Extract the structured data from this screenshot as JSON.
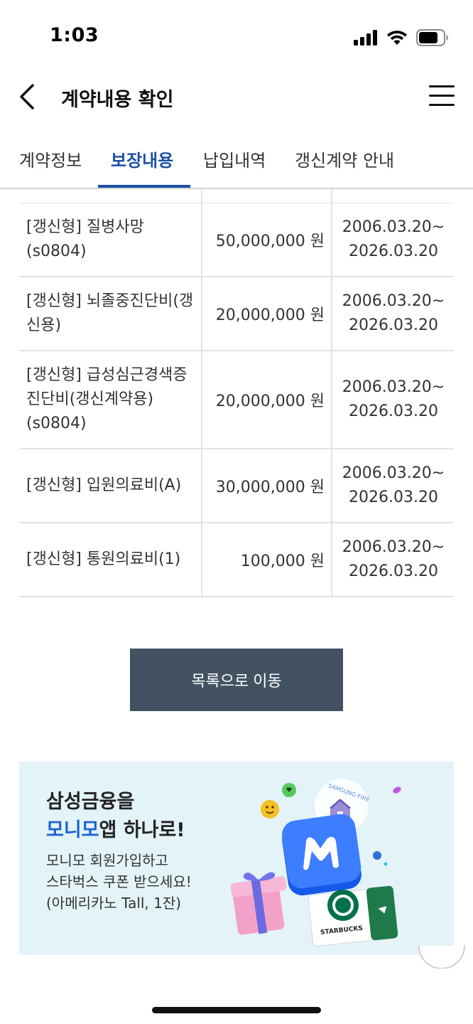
{
  "status": {
    "time": "1:03"
  },
  "header": {
    "title": "계약내용 확인"
  },
  "tabs": [
    {
      "label": "계약정보"
    },
    {
      "label": "보장내용"
    },
    {
      "label": "납입내역"
    },
    {
      "label": "갱신계약 안내"
    }
  ],
  "coverage": [
    {
      "name": "[갱신형] 질병사망(s0804)",
      "amount": "50,000,000 원",
      "period_start": "2006.03.20~",
      "period_end": "2026.03.20"
    },
    {
      "name": "[갱신형] 뇌졸중진단비(갱신용)",
      "amount": "20,000,000 원",
      "period_start": "2006.03.20~",
      "period_end": "2026.03.20"
    },
    {
      "name": "[갱신형] 급성심근경색증진단비(갱신계약용)(s0804)",
      "amount": "20,000,000 원",
      "period_start": "2006.03.20~",
      "period_end": "2026.03.20"
    },
    {
      "name": "[갱신형] 입원의료비(A)",
      "amount": "30,000,000 원",
      "period_start": "2006.03.20~",
      "period_end": "2026.03.20"
    },
    {
      "name": "[갱신형] 통원의료비(1)",
      "amount": "100,000 원",
      "period_start": "2006.03.20~",
      "period_end": "2026.03.20"
    }
  ],
  "list_button": "목록으로 이동",
  "banner": {
    "title_line1": "삼성금융을",
    "title_accent": "모니모",
    "title_rest": "앱 하나로!",
    "desc_line1": "모니모 회원가입하고",
    "desc_line2": "스타벅스 쿠폰 받으세요!",
    "desc_line3": "(아메리카노 Tall, 1잔)",
    "badge_text": "SAMSUNG FIRE",
    "card_text": "STARBUCKS"
  },
  "colors": {
    "accent": "#1c4fa6",
    "button_bg": "#435263",
    "banner_bg": "#e3f3f8"
  }
}
